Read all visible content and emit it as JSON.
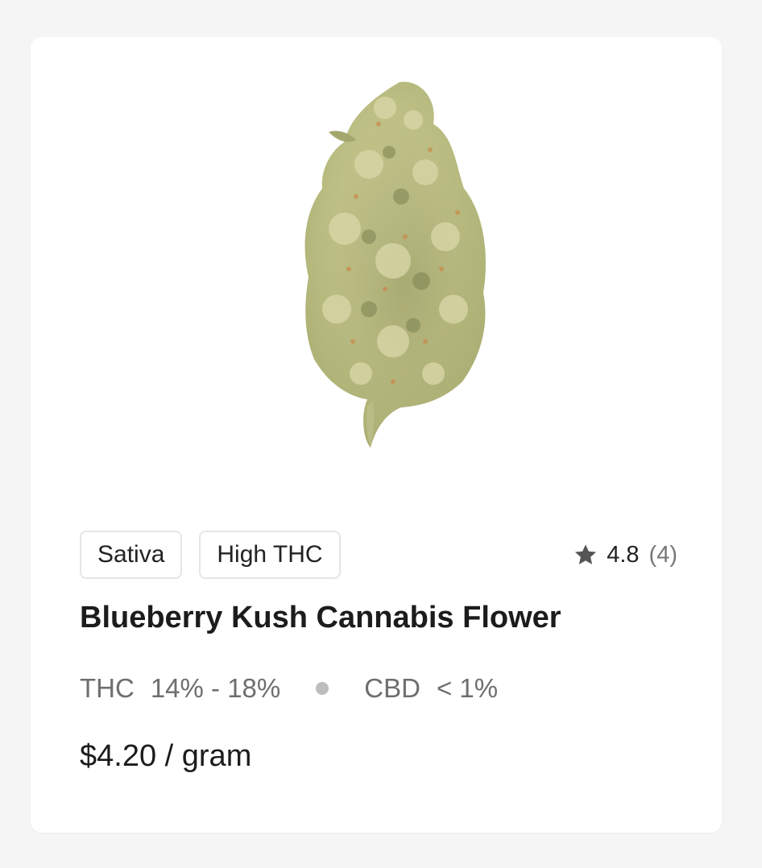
{
  "product": {
    "image_alt": "cannabis-flower-bud",
    "tags": [
      "Sativa",
      "High THC"
    ],
    "rating": {
      "icon": "star-icon",
      "value": "4.8",
      "count": "(4)"
    },
    "name": "Blueberry Kush Cannabis Flower",
    "thc_label": "THC",
    "thc_value": "14% - 18%",
    "cbd_label": "CBD",
    "cbd_value": "< 1%",
    "price": "$4.20 / gram"
  },
  "colors": {
    "background": "#f5f5f5",
    "card": "#ffffff",
    "text_primary": "#1c1c1c",
    "text_secondary": "#6e6e6e",
    "tag_border": "#e6e6e6",
    "star": "#555555"
  }
}
